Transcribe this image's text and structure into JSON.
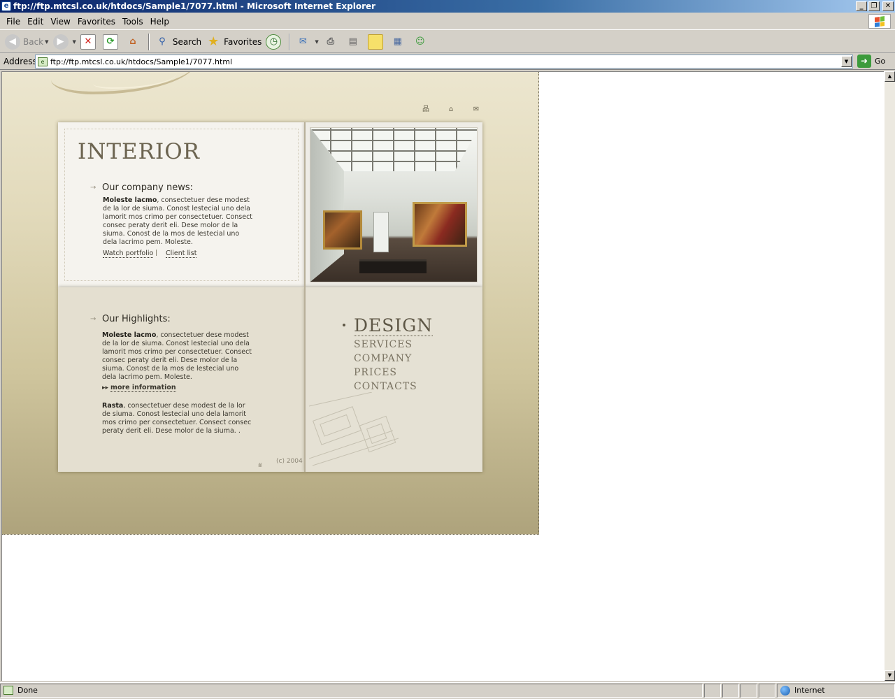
{
  "window": {
    "title": "ftp://ftp.mtcsl.co.uk/htdocs/Sample1/7077.html - Microsoft Internet Explorer",
    "controls": {
      "minimize": "_",
      "maximize": "❐",
      "close": "✕"
    }
  },
  "menubar": {
    "items": [
      {
        "label": "File"
      },
      {
        "label": "Edit"
      },
      {
        "label": "View"
      },
      {
        "label": "Favorites"
      },
      {
        "label": "Tools"
      },
      {
        "label": "Help"
      }
    ]
  },
  "toolbar": {
    "back_label": "Back",
    "search_label": "Search",
    "favorites_label": "Favorites"
  },
  "address": {
    "label": "Address",
    "url": "ftp://ftp.mtcsl.co.uk/htdocs/Sample1/7077.html",
    "go_label": "Go"
  },
  "page": {
    "brand": "INTERIOR",
    "news": {
      "title": "Our company news:",
      "lead": "Moleste lacmo",
      "text": ", consectetuer dese modest de la lor de siuma. Conost lestecial uno dela lamorit mos crimo per consectetuer. Consect consec peraty derit eli. Dese molor de la siuma. Conost de la mos de lestecial uno dela lacrimo pem. Moleste.",
      "link1": "Watch portfolio",
      "separator": "|",
      "link2": "Client list"
    },
    "highlights": {
      "title": "Our Highlights:",
      "lead": "Moleste lacmo",
      "text": ", consectetuer dese modest de la lor de siuma. Conost lestecial uno dela lamorit mos crimo per consectetuer. Consect consec peraty derit eli. Dese molor de la siuma. Conost de la mos de lestecial uno dela lacrimo pem. Moleste.",
      "more_label": "more information",
      "lead2": "Rasta",
      "text2": ", consectetuer dese modest de la lor de siuma. Conost lestecial uno dela lamorit mos crimo per consectetuer. Consect consec peraty derit eli. Dese molor de la siuma. ."
    },
    "nav": {
      "active": "DESIGN",
      "items": [
        "SERVICES",
        "COMPANY",
        "PRICES",
        "CONTACTS"
      ]
    },
    "copyright": "(c) 2004",
    "icons": [
      "sitemap-icon",
      "home-icon",
      "mail-icon"
    ]
  },
  "status": {
    "text": "Done",
    "zone": "Internet"
  },
  "colors": {
    "titlebar": "#0a246a",
    "chrome": "#d4d0c8",
    "page_bg_top": "#ece6cf",
    "page_bg_bottom": "#aea37c",
    "brand_text": "#6c6450"
  }
}
